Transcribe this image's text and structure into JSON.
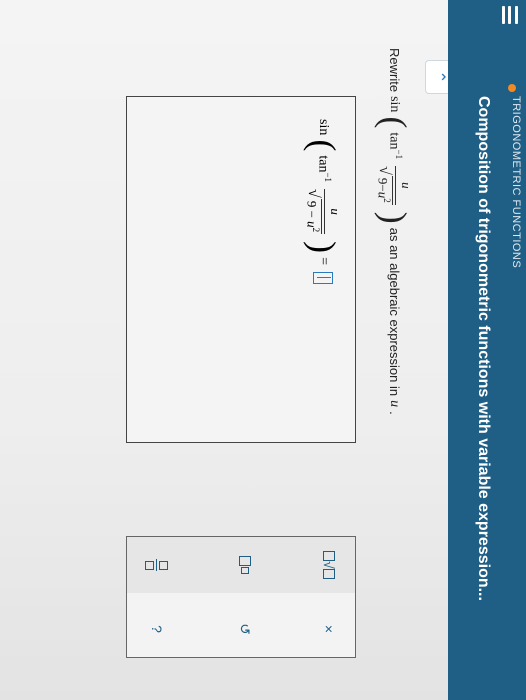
{
  "header": {
    "topic": "TRIGONOMETRIC FUNCTIONS",
    "title": "Composition of trigonometric functions with variable expression..."
  },
  "colors": {
    "header_bg": "#1f5f86",
    "accent": "#2a7bbd",
    "topic_dot": "#f08a24"
  },
  "prompt": {
    "lead": "Rewrite",
    "sin": "sin",
    "tan": "tan",
    "exp": "−1",
    "num": "u",
    "den_a": "9",
    "den_op": "−",
    "den_var": "u",
    "den_exp": "2",
    "tail": "as an algebraic expression in",
    "tail_var": "u",
    "period": "."
  },
  "answer": {
    "equals": "="
  },
  "keypad": {
    "keys": {
      "sqrt": "√",
      "times": "×",
      "undo": "↺",
      "help": "?"
    }
  },
  "icons": [
    "menu-icon",
    "chevron-up-icon",
    "sqrt-icon",
    "superscript-icon",
    "fraction-icon",
    "clear-icon",
    "undo-icon",
    "help-icon"
  ]
}
